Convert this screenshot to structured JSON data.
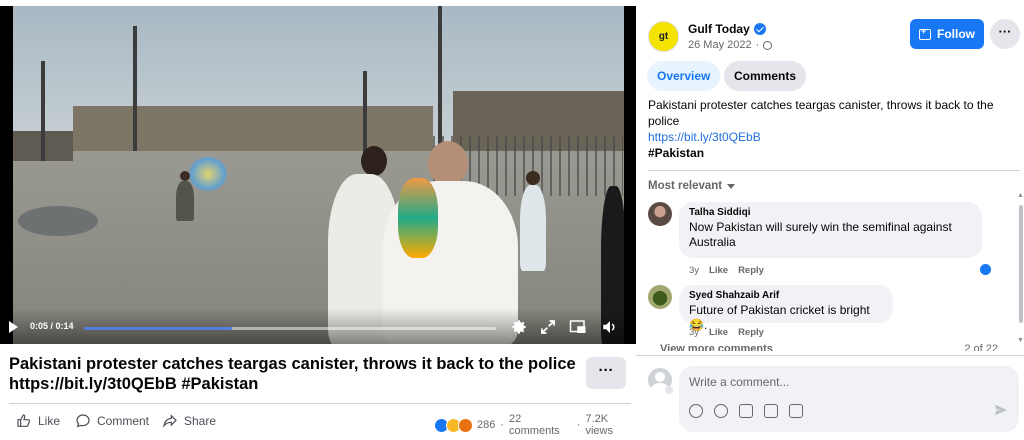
{
  "video": {
    "time_current": "0:05",
    "time_total": "0:14",
    "progress_fraction": 0.36
  },
  "post": {
    "title_line1": "Pakistani protester catches teargas canister, throws it back to the police",
    "title_line2": "https://bit.ly/3t0QEbB #Pakistan",
    "more_label": "···",
    "actions": {
      "like": "Like",
      "comment": "Comment",
      "share": "Share"
    },
    "reaction_count": "286",
    "comments_count": "22 comments",
    "views_count": "7.2K views",
    "separator": "·"
  },
  "side": {
    "page_name": "Gulf Today",
    "logo_text": "gt",
    "date": "26 May 2022",
    "date_separator": "·",
    "follow_label": "Follow",
    "more_label": "···",
    "tabs": [
      {
        "label": "Overview",
        "active": true
      },
      {
        "label": "Comments",
        "active": false
      }
    ],
    "caption": "Pakistani protester catches teargas canister, throws it back to the police",
    "link": "https://bit.ly/3t0QEbB",
    "hashtag": "#Pakistan",
    "sort_label": "Most relevant",
    "comments": [
      {
        "name": "Talha Siddiqi",
        "text": "Now Pakistan will surely win the semifinal against Australia",
        "age": "3y",
        "like": "Like",
        "reply": "Reply",
        "avatar_color": "#8a6e62"
      },
      {
        "name": "Syed Shahzaib Arif",
        "text": "Future of Pakistan cricket is bright😂.",
        "age": "3y",
        "like": "Like",
        "reply": "Reply",
        "avatar_color": "#7a8a3a"
      }
    ],
    "view_more": "View more comments",
    "view_count": "2 of 22",
    "compose_placeholder": "Write a comment..."
  },
  "colors": {
    "accent": "#1877f2",
    "link": "#216fdb",
    "bubble": "#f0f2f5"
  }
}
